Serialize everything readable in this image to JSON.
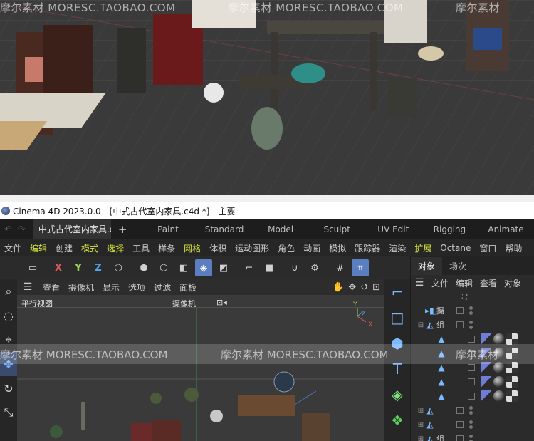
{
  "render_preview": {
    "watermark": [
      "摩尔素材  MORESC.TAOBAO.COM",
      "摩尔素材  MORESC.TAOBAO.COM",
      "摩尔素材"
    ]
  },
  "window": {
    "title": "Cinema 4D 2023.0.0 - [中式古代室内家具.c4d *] - 主要"
  },
  "tabbar": {
    "document_tab": "中式古代室内家具.c4d",
    "plus": "+",
    "layouts": [
      "Paint",
      "Standard",
      "Model",
      "Sculpt",
      "UV Edit",
      "Rigging",
      "Animate"
    ]
  },
  "menubar": {
    "items": [
      {
        "label": "文件",
        "highlight": false
      },
      {
        "label": "编辑",
        "highlight": true
      },
      {
        "label": "创建",
        "highlight": false
      },
      {
        "label": "模式",
        "highlight": true
      },
      {
        "label": "选择",
        "highlight": true
      },
      {
        "label": "工具",
        "highlight": false
      },
      {
        "label": "样条",
        "highlight": false
      },
      {
        "label": "网格",
        "highlight": true
      },
      {
        "label": "体积",
        "highlight": false
      },
      {
        "label": "运动图形",
        "highlight": false
      },
      {
        "label": "角色",
        "highlight": false
      },
      {
        "label": "动画",
        "highlight": false
      },
      {
        "label": "模拟",
        "highlight": false
      },
      {
        "label": "跟踪器",
        "highlight": false
      },
      {
        "label": "渲染",
        "highlight": false
      },
      {
        "label": "扩展",
        "highlight": true
      },
      {
        "label": "Octane",
        "highlight": false
      },
      {
        "label": "窗口",
        "highlight": false
      },
      {
        "label": "帮助",
        "highlight": false
      }
    ]
  },
  "toolbar": {
    "x": "X",
    "y": "Y",
    "z": "Z"
  },
  "viewport": {
    "menu": [
      "查看",
      "摄像机",
      "显示",
      "选项",
      "过滤",
      "面板"
    ],
    "view_name": "平行视图",
    "camera_label": "摄像机"
  },
  "object_manager": {
    "tabs": [
      "对象",
      "场次"
    ],
    "menu": [
      "文件",
      "编辑",
      "查看",
      "对象"
    ],
    "rows": [
      {
        "expander": "",
        "icon": "camera-icon",
        "name": "摄"
      },
      {
        "expander": "⊟",
        "icon": "null-icon",
        "name": "组"
      },
      {
        "expander": "",
        "icon": "light-icon",
        "name": ""
      },
      {
        "expander": "",
        "icon": "light-icon",
        "name": ""
      },
      {
        "expander": "",
        "icon": "light-icon",
        "name": ""
      },
      {
        "expander": "",
        "icon": "light-icon",
        "name": ""
      },
      {
        "expander": "",
        "icon": "light-icon",
        "name": ""
      },
      {
        "expander": "⊞",
        "icon": "null-icon",
        "name": ""
      },
      {
        "expander": "⊞",
        "icon": "null-icon",
        "name": ""
      },
      {
        "expander": "⊞",
        "icon": "null-icon",
        "name": "组"
      }
    ]
  },
  "mid_watermark": [
    "摩尔素材  MORESC.TAOBAO.COM",
    "摩尔素材  MORESC.TAOBAO.COM",
    "摩尔素材"
  ]
}
